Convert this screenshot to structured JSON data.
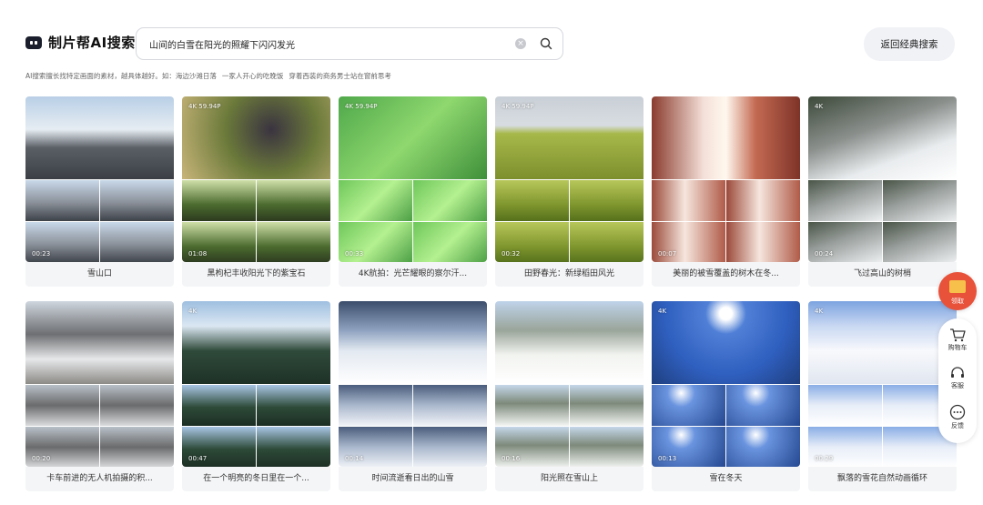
{
  "header": {
    "logo_text": "制片帮AI搜索",
    "search_value": "山间的白雪在阳光的照耀下闪闪发光",
    "classic_button": "返回经典搜索"
  },
  "hint": {
    "text": "AI搜索擅长找特定画面的素材，越具体越好。如：",
    "examples": [
      "海边沙滩日落",
      "一家人开心的吃晚饭",
      "穿着西装的商务男士站在窗前思考"
    ]
  },
  "cards": [
    {
      "title": "雪山口",
      "duration": "00:23",
      "badge": ""
    },
    {
      "title": "黑枸杞丰收阳光下的紫宝石",
      "duration": "01:08",
      "badge": "4K  59.94P"
    },
    {
      "title": "4K航拍：光芒耀眼的察尔汗...",
      "duration": "00:33",
      "badge": "4K  59.94P"
    },
    {
      "title": "田野春光：新绿稻田风光",
      "duration": "00:32",
      "badge": "4K  59.94P"
    },
    {
      "title": "美丽的被雪覆盖的树木在冬...",
      "duration": "00:07",
      "badge": ""
    },
    {
      "title": "飞过高山的树梢",
      "duration": "00:24",
      "badge": "4K"
    },
    {
      "title": "卡车前进的无人机拍摄的积...",
      "duration": "00:20",
      "badge": ""
    },
    {
      "title": "在一个明亮的冬日里在一个...",
      "duration": "00:47",
      "badge": "4K"
    },
    {
      "title": "时间流逝看日出的山雪",
      "duration": "00:14",
      "badge": ""
    },
    {
      "title": "阳光照在雪山上",
      "duration": "00:16",
      "badge": ""
    },
    {
      "title": "雪在冬天",
      "duration": "00:13",
      "badge": "4K"
    },
    {
      "title": "飘落的雪花自然动画循环",
      "duration": "00:29",
      "badge": "4K"
    }
  ],
  "sidebar": {
    "gift_label": "领取",
    "items": [
      {
        "label": "购物车",
        "icon": "cart-icon"
      },
      {
        "label": "客服",
        "icon": "headset-icon"
      },
      {
        "label": "反馈",
        "icon": "feedback-icon"
      }
    ]
  }
}
